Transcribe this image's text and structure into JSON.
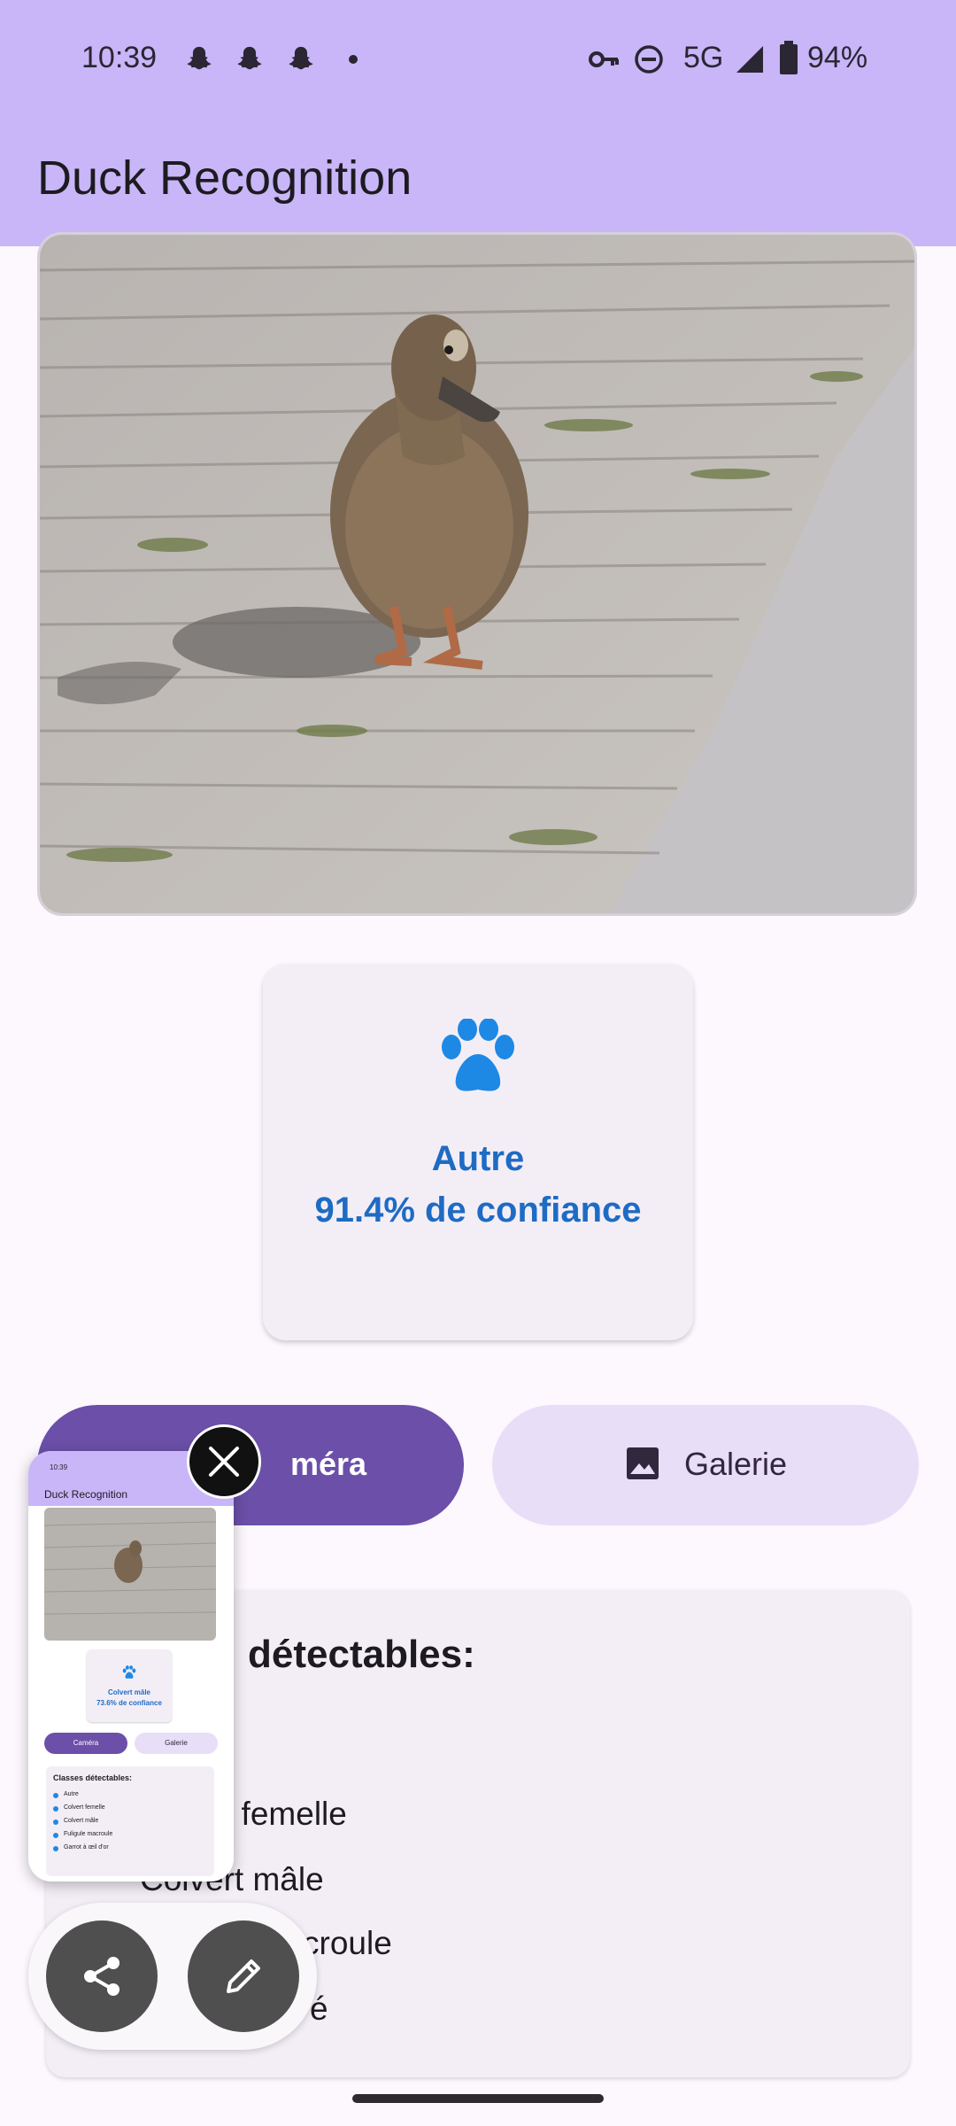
{
  "status_bar": {
    "time": "10:39",
    "network": "5G",
    "battery": "94%",
    "notification_icons": [
      "snapchat-icon",
      "snapchat-icon",
      "snapchat-icon"
    ]
  },
  "app": {
    "title": "Duck Recognition"
  },
  "result": {
    "icon": "paw-icon",
    "label": "Autre",
    "confidence_text": "91.4% de confiance"
  },
  "buttons": {
    "camera_label": "Caméra",
    "camera_visible_label": "méra",
    "gallery_label": "Galerie"
  },
  "classes": {
    "heading_visible": "détectables:",
    "items_visible": [
      "t femelle",
      "Colvert mâle",
      "croule",
      "é"
    ]
  },
  "screenshot_preview": {
    "title": "Duck Recognition",
    "status_time": "10:39",
    "result_label": "Colvert mâle",
    "result_confidence": "73.6% de confiance",
    "camera_label": "Caméra",
    "gallery_label": "Galerie",
    "classes_heading": "Classes détectables:",
    "classes": [
      "Autre",
      "Colvert femelle",
      "Colvert mâle",
      "Fuligule macroule",
      "Garrot à œil d'or"
    ]
  },
  "colors": {
    "app_bar": "#c8b6f8",
    "accent_blue": "#1e6bc4",
    "camera_button": "#6b4fa8",
    "gallery_button": "#e8def8",
    "background": "#fdf7fe"
  }
}
